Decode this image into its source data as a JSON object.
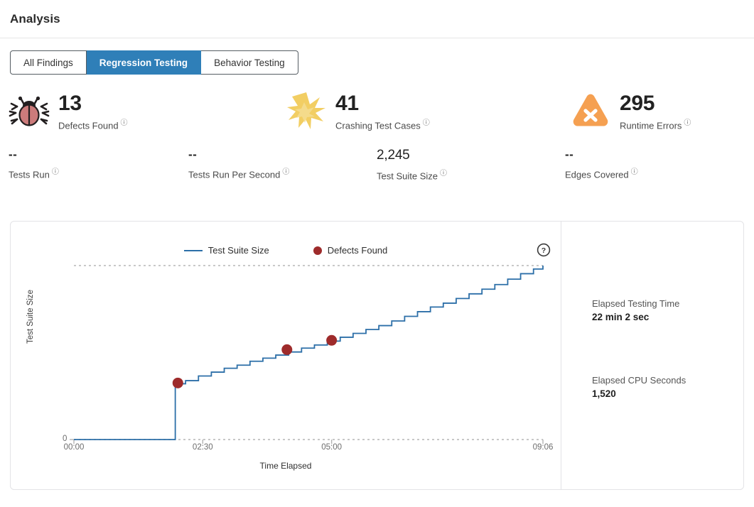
{
  "header": {
    "title": "Analysis"
  },
  "tabs": [
    {
      "label": "All Findings",
      "active": false
    },
    {
      "label": "Regression Testing",
      "active": true
    },
    {
      "label": "Behavior Testing",
      "active": false
    }
  ],
  "stats_primary": [
    {
      "icon": "bug-icon",
      "value": "13",
      "label": "Defects Found",
      "help": "?"
    },
    {
      "icon": "explosion-icon",
      "value": "41",
      "label": "Crashing Test Cases",
      "help": "?"
    },
    {
      "icon": "warning-x-icon",
      "value": "295",
      "label": "Runtime Errors",
      "help": "?"
    }
  ],
  "stats_secondary": [
    {
      "value": "--",
      "label": "Tests Run",
      "help": "?"
    },
    {
      "value": "--",
      "label": "Tests Run Per Second",
      "help": "?"
    },
    {
      "value": "2,245",
      "label": "Test Suite Size",
      "help": "?"
    },
    {
      "value": "--",
      "label": "Edges Covered",
      "help": "?"
    }
  ],
  "chart_panel": {
    "help_icon": "question-circle-icon",
    "blocks": [
      {
        "label": "Elapsed Testing Time",
        "value": "22 min 2 sec"
      },
      {
        "label": "Elapsed CPU Seconds",
        "value": "1,520"
      }
    ]
  },
  "colors": {
    "accent_blue": "#2f7fb8",
    "line_blue": "#2c6fa8",
    "defect_red": "#9e2b2b",
    "bug_body": "#cc7b7b",
    "explosion_yellow": "#f2ce63",
    "warning_orange": "#f5a051"
  },
  "chart_data": {
    "type": "line",
    "title": "",
    "xlabel": "Time Elapsed",
    "ylabel": "Test Suite Size",
    "xlim": [
      0,
      546
    ],
    "ylim": [
      0,
      2245
    ],
    "grid": false,
    "top_gridline_value": 2245,
    "legend_position": "top-center",
    "xtick_labels": [
      "00:00",
      "02:30",
      "05:00",
      "09:06"
    ],
    "xtick_values": [
      0,
      150,
      300,
      546
    ],
    "ytick_labels": [
      "0"
    ],
    "ytick_values": [
      0
    ],
    "series": [
      {
        "name": "Test Suite Size",
        "type": "step",
        "color": "#2c6fa8",
        "x": [
          0,
          118,
          118,
          130,
          145,
          160,
          175,
          190,
          205,
          220,
          235,
          250,
          265,
          280,
          295,
          310,
          325,
          340,
          355,
          370,
          385,
          400,
          415,
          430,
          445,
          460,
          475,
          490,
          505,
          520,
          535,
          546
        ],
        "y": [
          0,
          0,
          720,
          760,
          820,
          870,
          920,
          960,
          1010,
          1050,
          1090,
          1130,
          1180,
          1220,
          1270,
          1320,
          1370,
          1420,
          1470,
          1530,
          1590,
          1650,
          1710,
          1760,
          1820,
          1880,
          1940,
          2000,
          2070,
          2140,
          2200,
          2245
        ]
      },
      {
        "name": "Defects Found",
        "type": "scatter",
        "color": "#9e2b2b",
        "x": [
          121,
          248,
          300
        ],
        "y": [
          730,
          1160,
          1280
        ]
      }
    ]
  }
}
